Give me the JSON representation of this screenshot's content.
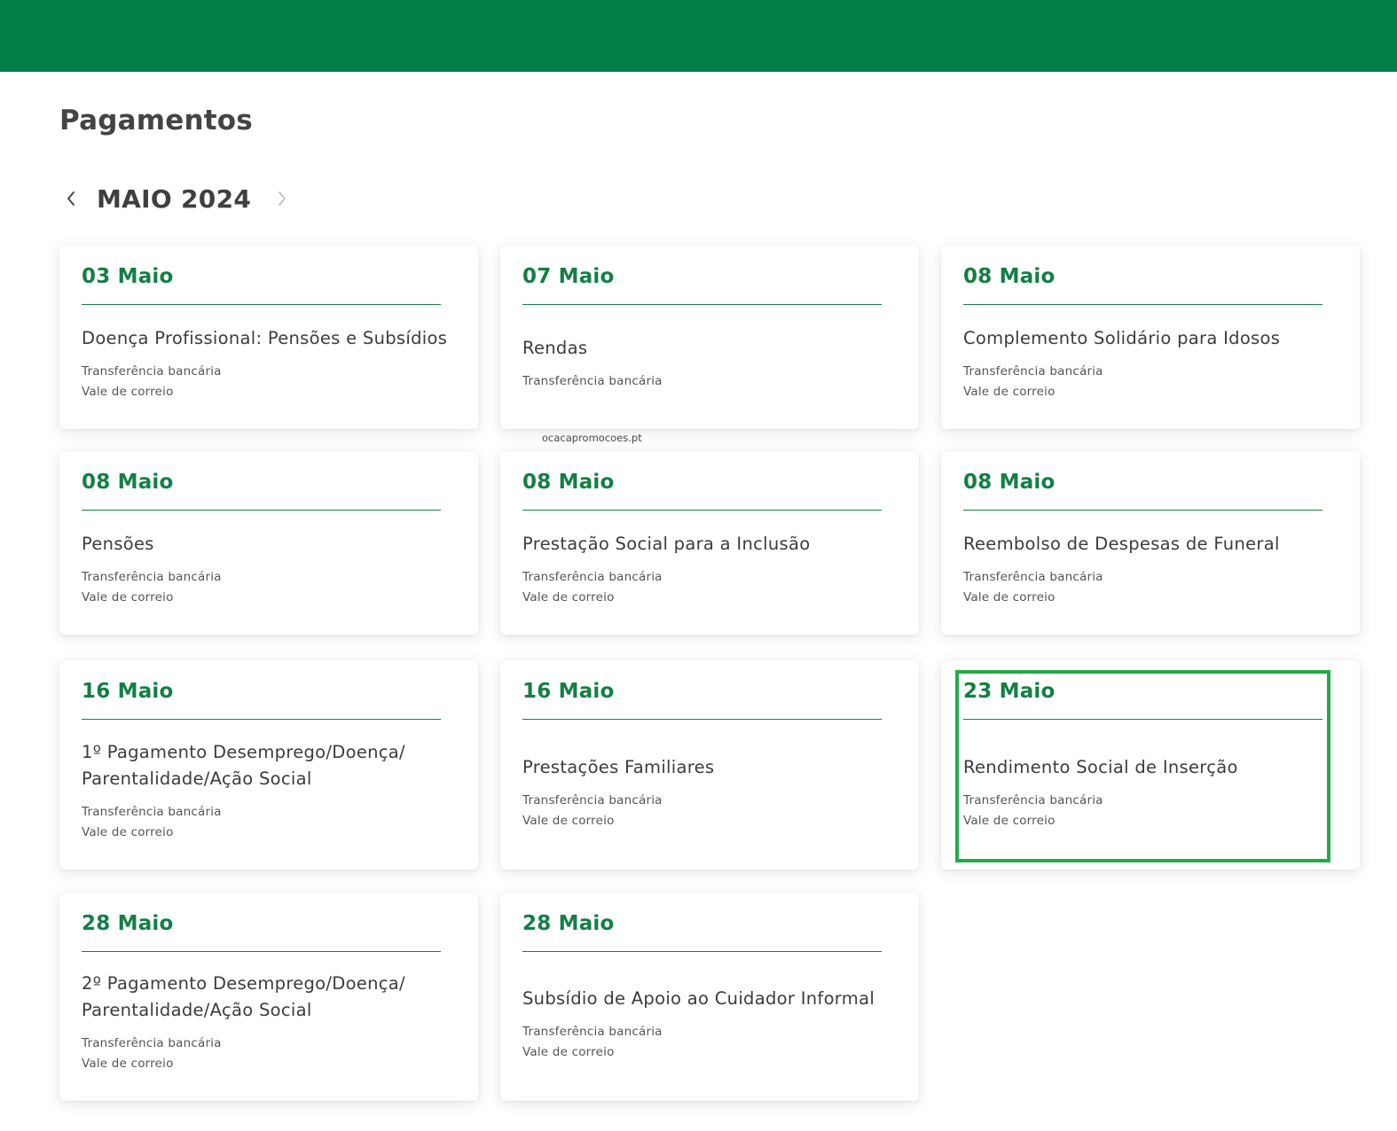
{
  "page": {
    "title": "Pagamentos",
    "month_label": "MAIO 2024",
    "watermark": "ocacapromocoes.pt"
  },
  "nav": {
    "prev_icon": "chevron-left-icon",
    "next_icon": "chevron-right-icon"
  },
  "colors": {
    "header_bg": "#017f47",
    "accent_green": "#137f45",
    "highlight_border": "#22ac49"
  },
  "cards": [
    {
      "date": "03 Maio",
      "title": "Doença Profissional: Pensões e Subsídios",
      "methods": [
        "Transferência bancária",
        "Vale de correio"
      ]
    },
    {
      "date": "07 Maio",
      "title": "Rendas",
      "methods": [
        "Transferência bancária"
      ]
    },
    {
      "date": "08 Maio",
      "title": "Complemento Solidário para Idosos",
      "methods": [
        "Transferência bancária",
        "Vale de correio"
      ]
    },
    {
      "date": "08 Maio",
      "title": "Pensões",
      "methods": [
        "Transferência bancária",
        "Vale de correio"
      ]
    },
    {
      "date": "08 Maio",
      "title": "Prestação Social para a Inclusão",
      "methods": [
        "Transferência bancária",
        "Vale de correio"
      ]
    },
    {
      "date": "08 Maio",
      "title": "Reembolso de Despesas de Funeral",
      "methods": [
        "Transferência bancária",
        "Vale de correio"
      ]
    },
    {
      "date": "16 Maio",
      "title": "1º Pagamento Desemprego/Doença/ Parentalidade/Ação Social",
      "methods": [
        "Transferência bancária",
        "Vale de correio"
      ]
    },
    {
      "date": "16 Maio",
      "title": "Prestações Familiares",
      "methods": [
        "Transferência bancária",
        "Vale de correio"
      ]
    },
    {
      "date": "23 Maio",
      "title": "Rendimento Social de Inserção",
      "methods": [
        "Transferência bancária",
        "Vale de correio"
      ]
    },
    {
      "date": "28 Maio",
      "title": "2º Pagamento Desemprego/Doença/ Parentalidade/Ação Social",
      "methods": [
        "Transferência bancária",
        "Vale de correio"
      ]
    },
    {
      "date": "28 Maio",
      "title": "Subsídio de Apoio ao Cuidador Informal",
      "methods": [
        "Transferência bancária",
        "Vale de correio"
      ]
    }
  ]
}
